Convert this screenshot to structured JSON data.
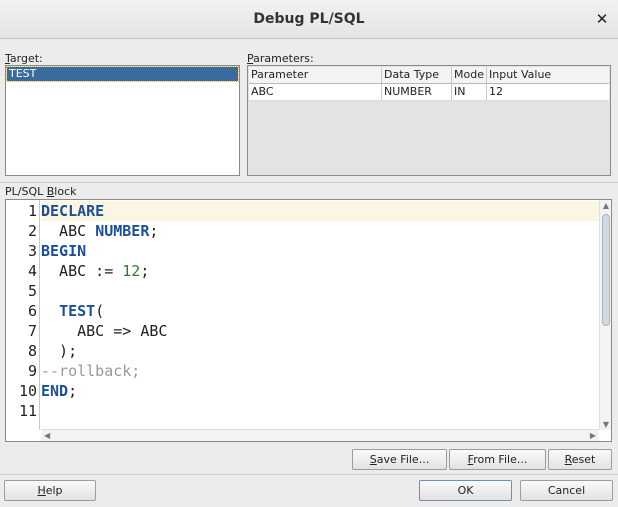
{
  "window": {
    "title": "Debug PL/SQL",
    "close_glyph": "✕"
  },
  "target": {
    "label_mnemonic": "T",
    "label_rest": "arget:",
    "items": [
      "TEST"
    ]
  },
  "parameters": {
    "label_mnemonic": "P",
    "label_rest": "arameters:",
    "columns": [
      "Parameter",
      "Data Type",
      "Mode",
      "Input Value"
    ],
    "rows": [
      [
        "ABC",
        "NUMBER",
        "IN",
        "12"
      ]
    ]
  },
  "block": {
    "label_pre": "PL/SQL ",
    "label_mnemonic": "B",
    "label_rest": "lock",
    "lines": [
      {
        "n": "1",
        "tokens": [
          {
            "t": "DECLARE",
            "c": "kw-bold"
          }
        ]
      },
      {
        "n": "2",
        "tokens": [
          {
            "t": "  ABC ",
            "c": ""
          },
          {
            "t": "NUMBER",
            "c": "kw-bold"
          },
          {
            "t": ";",
            "c": ""
          }
        ]
      },
      {
        "n": "3",
        "tokens": [
          {
            "t": "BEGIN",
            "c": "kw-bold"
          }
        ]
      },
      {
        "n": "4",
        "tokens": [
          {
            "t": "  ABC := ",
            "c": ""
          },
          {
            "t": "12",
            "c": "num"
          },
          {
            "t": ";",
            "c": ""
          }
        ]
      },
      {
        "n": "5",
        "tokens": []
      },
      {
        "n": "6",
        "tokens": [
          {
            "t": "  ",
            "c": ""
          },
          {
            "t": "TEST",
            "c": "kw-bold"
          },
          {
            "t": "(",
            "c": ""
          }
        ]
      },
      {
        "n": "7",
        "tokens": [
          {
            "t": "    ABC => ABC",
            "c": ""
          }
        ]
      },
      {
        "n": "8",
        "tokens": [
          {
            "t": "  );",
            "c": ""
          }
        ]
      },
      {
        "n": "9",
        "tokens": [
          {
            "t": "--rollback;",
            "c": "cmt"
          }
        ]
      },
      {
        "n": "10",
        "tokens": [
          {
            "t": "END",
            "c": "kw-bold"
          },
          {
            "t": ";",
            "c": ""
          }
        ]
      },
      {
        "n": "11",
        "tokens": []
      }
    ]
  },
  "buttons": {
    "save_file": {
      "mn": "S",
      "rest": "ave File..."
    },
    "from_file": {
      "mn": "F",
      "rest": "rom File..."
    },
    "reset": {
      "mn": "R",
      "rest": "eset"
    },
    "help": {
      "mn": "H",
      "rest": "elp"
    },
    "ok": "OK",
    "cancel": "Cancel"
  },
  "colors": {
    "selection": "#3a6b9e",
    "keyword": "#1b4f9c",
    "number": "#2e7d2e",
    "comment": "#999999",
    "current_line": "#fbf6e2"
  }
}
